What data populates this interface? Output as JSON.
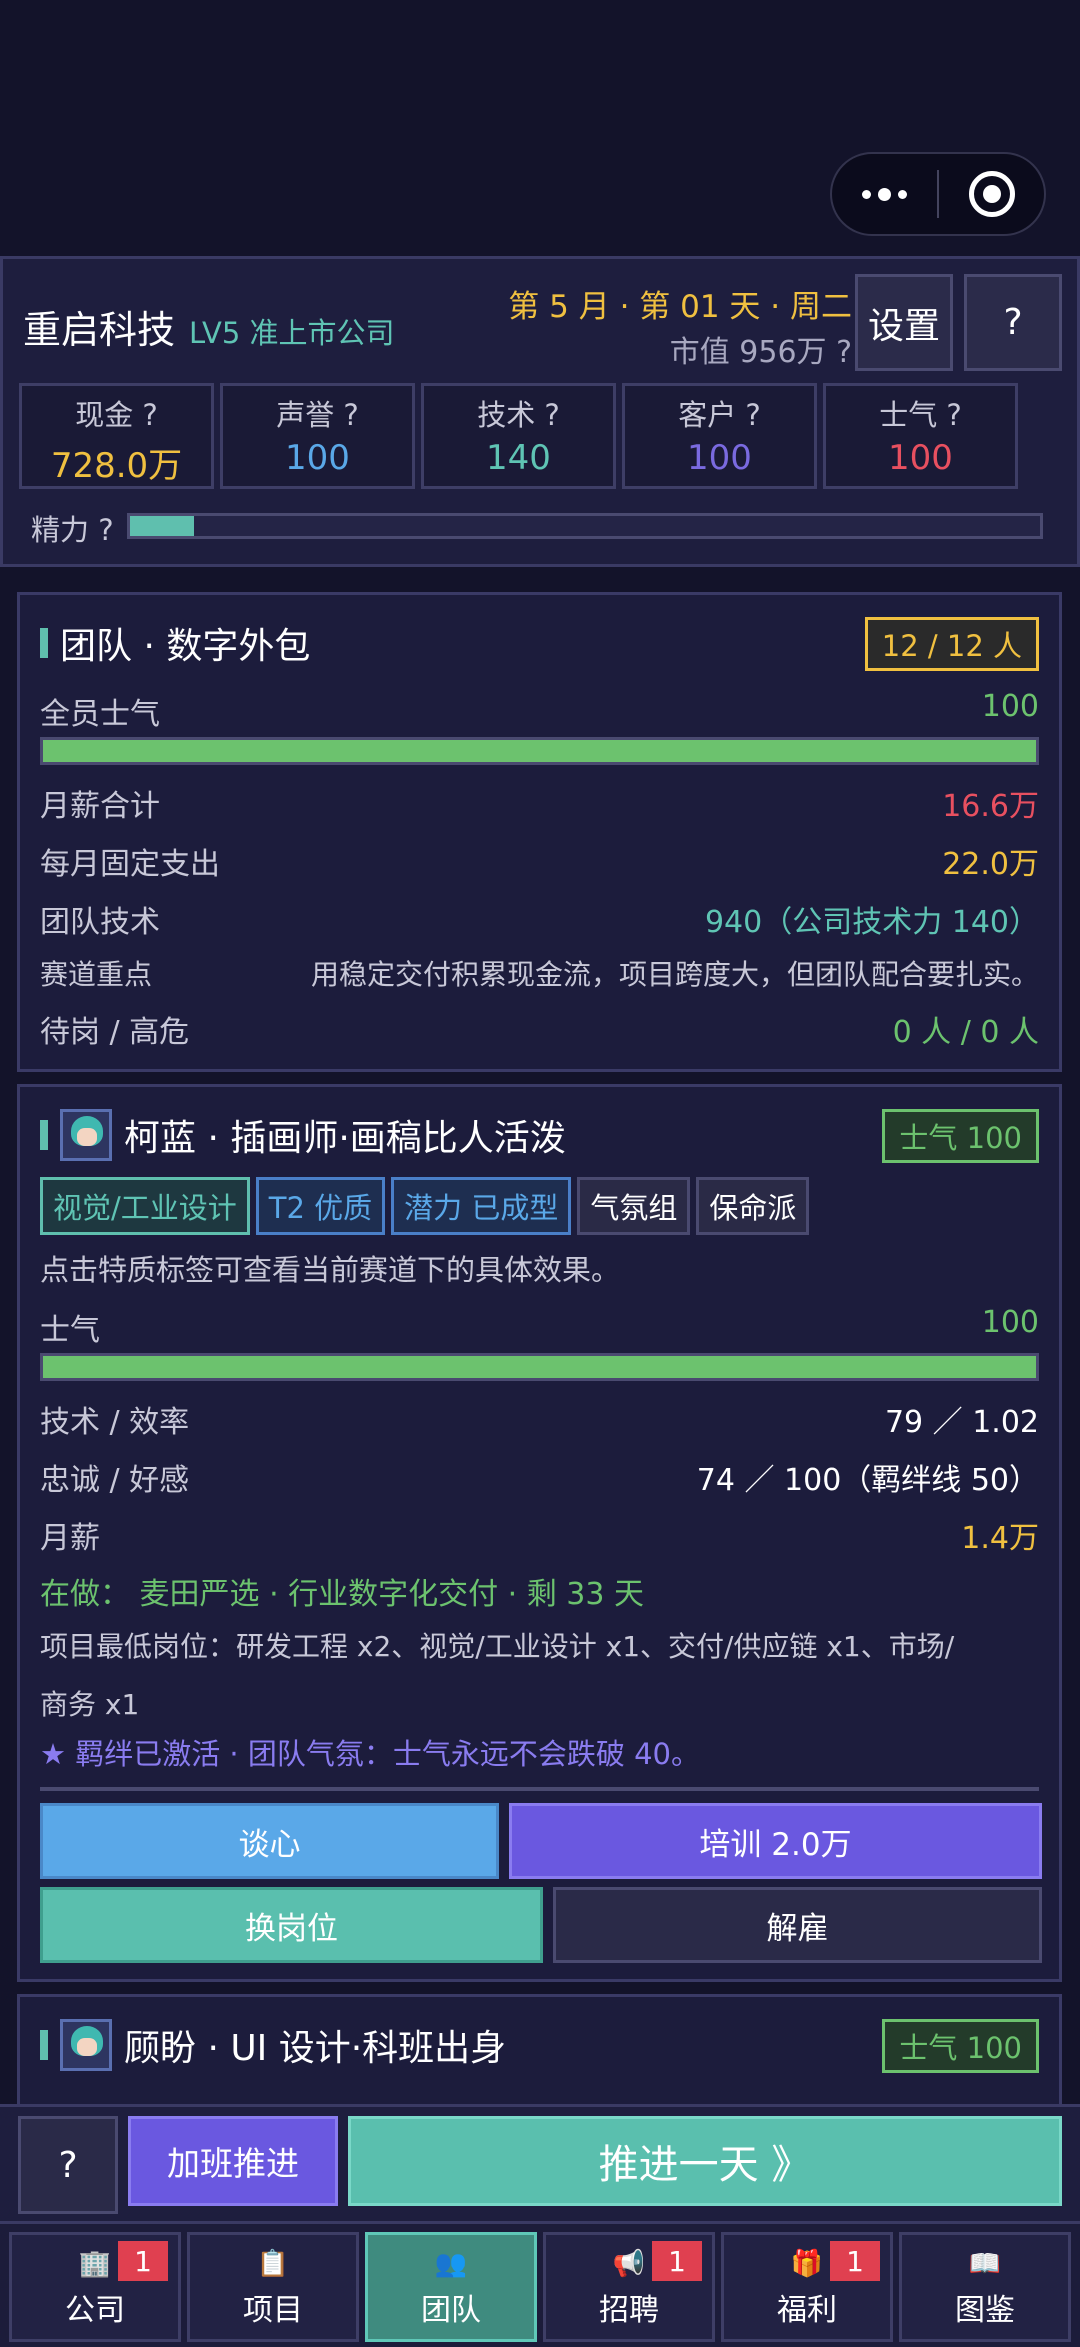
{
  "company": {
    "name": "重启科技",
    "level": "LV5 准上市公司"
  },
  "date": "第 5 月 · 第 01 天 · 周二",
  "market_value": "市值 956万 ?",
  "header_buttons": {
    "settings": "设置",
    "help": "?"
  },
  "stats": [
    {
      "label": "现金 ?",
      "value": "728.0万",
      "color": "#f0c040"
    },
    {
      "label": "声誉 ?",
      "value": "100",
      "color": "#5aa8e8"
    },
    {
      "label": "技术 ?",
      "value": "140",
      "color": "#5fc4b4"
    },
    {
      "label": "客户 ?",
      "value": "100",
      "color": "#7a6ae0"
    },
    {
      "label": "士气 ?",
      "value": "100",
      "color": "#e85060"
    }
  ],
  "energy": {
    "label": "精力 ?",
    "fraction": 0.07
  },
  "team": {
    "title": "团队 · 数字外包",
    "headcount": "12 / 12 人",
    "morale_label": "全员士气",
    "morale_value": "100",
    "morale_fraction": 1.0,
    "salary_label": "月薪合计",
    "salary_value": "16.6万",
    "fixed_label": "每月固定支出",
    "fixed_value": "22.0万",
    "tech_label": "团队技术",
    "tech_value": "940（公司技术力 140）",
    "focus_label": "赛道重点",
    "focus_value": "用稳定交付积累现金流，项目跨度大，但团队配合要扎实。",
    "idle_label": "待岗 / 高危",
    "idle_value": "0 人 / 0 人"
  },
  "employee1": {
    "name": "柯蓝 · 插画师·画稿比人活泼",
    "morale_pill": "士气 100",
    "tags": [
      "视觉/工业设计",
      "T2 优质",
      "潜力 已成型",
      "气氛组",
      "保命派"
    ],
    "hint": "点击特质标签可查看当前赛道下的具体效果。",
    "morale_label": "士气",
    "morale_value": "100",
    "morale_fraction": 1.0,
    "tech_label": "技术 / 效率",
    "tech_value": "79 ／ 1.02",
    "loyalty_label": "忠诚 / 好感",
    "loyalty_value": "74 ／ 100（羁绊线 50）",
    "salary_label": "月薪",
    "salary_value": "1.4万",
    "doing": "在做： 麦田严选 · 行业数字化交付 · 剩 33 天",
    "roles_line1": "项目最低岗位：研发工程 x2、视觉/工业设计 x1、交付/供应链 x1、市场/",
    "roles_line2": "商务 x1",
    "bond": "★ 羁绊已激活 · 团队气氛：士气永远不会跌破 40。",
    "buttons": {
      "talk": "谈心",
      "train": "培训 2.0万",
      "swap": "换岗位",
      "fire": "解雇"
    }
  },
  "employee2": {
    "name": "顾盼 · UI 设计·科班出身",
    "morale_pill": "士气 100"
  },
  "bottom": {
    "help": "?",
    "overtime": "加班推进",
    "advance": "推进一天 》"
  },
  "nav": [
    {
      "label": "公司",
      "icon": "building-icon",
      "glyph": "🏢",
      "badge": "1"
    },
    {
      "label": "项目",
      "icon": "clipboard-icon",
      "glyph": "📋",
      "badge": ""
    },
    {
      "label": "团队",
      "icon": "team-icon",
      "glyph": "👥",
      "badge": ""
    },
    {
      "label": "招聘",
      "icon": "megaphone-icon",
      "glyph": "📢",
      "badge": "1"
    },
    {
      "label": "福利",
      "icon": "gift-icon",
      "glyph": "🎁",
      "badge": "1"
    },
    {
      "label": "图鉴",
      "icon": "book-icon",
      "glyph": "📖",
      "badge": ""
    }
  ]
}
